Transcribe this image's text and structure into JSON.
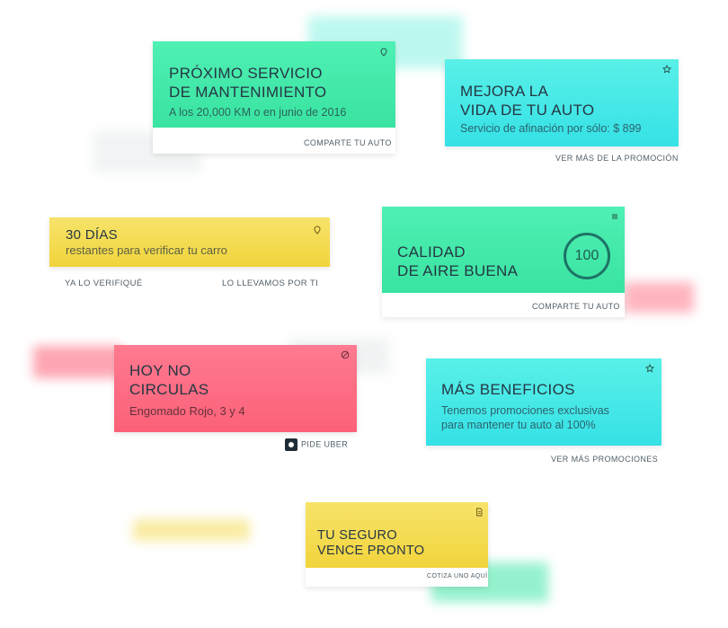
{
  "cards": {
    "servicio": {
      "title": "PRÓXIMO SERVICIO\nDE MANTENIMIENTO",
      "subtitle": "A los 20,000 KM o en junio de 2016",
      "link": "COMPARTE TU AUTO",
      "icon": "pin-icon"
    },
    "mejora": {
      "title": "MEJORA LA\nVIDA DE TU AUTO",
      "subtitle": "Servicio de afinación por sólo: $ 899",
      "link": "VER MÁS DE LA PROMOCIÓN",
      "icon": "star-icon"
    },
    "verificacion": {
      "title": "30 DÍAS",
      "subtitle": "restantes para verificar tu carro",
      "link_left": "YA LO VERIFIQUÉ",
      "link_right": "LO LLEVAMOS POR TI",
      "icon": "pin-icon"
    },
    "aire": {
      "title": "CALIDAD\nDE AIRE BUENA",
      "value": "100",
      "link": "COMPARTE TU AUTO",
      "icon": "menu-icon"
    },
    "circulas": {
      "title": "HOY NO\nCIRCULAS",
      "subtitle": "Engomado Rojo, 3 y 4",
      "link": "PIDE UBER",
      "icon": "no-entry-icon"
    },
    "beneficios": {
      "title": "MÁS BENEFICIOS",
      "subtitle": "Tenemos promociones  exclusivas\npara mantener tu auto al 100%",
      "link": "VER MÁS PROMOCIONES",
      "icon": "star-icon"
    },
    "seguro": {
      "title": "TU SEGURO\nVENCE PRONTO",
      "link": "COTIZA UNO AQUÍ",
      "icon": "document-icon"
    }
  },
  "colors": {
    "green": "#3fe7a6",
    "cyan": "#3fe4e8",
    "yellow": "#f4d94a",
    "red": "#fc6b80",
    "gauge": "#1d7366"
  }
}
